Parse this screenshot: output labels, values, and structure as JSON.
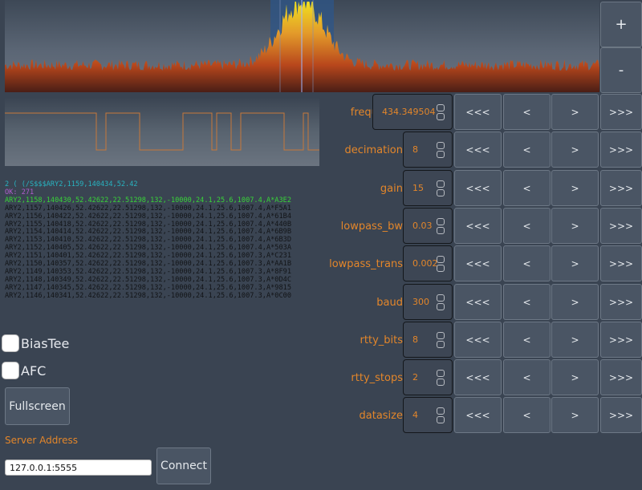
{
  "zoom": {
    "plus_label": "+",
    "minus_label": "-"
  },
  "log": {
    "top_line": "2 ( (/S$$$ARY2,1159,140434,52.42",
    "ok_line": "OK: 271",
    "new_line": "ARY2,1158,140430,52.42622,22.51298,132,-10000,24.1,25.6,1007.4,A*A3E2",
    "lines": [
      "ARY2,1157,140426,52.42622,22.51298,132,-10000,24.1,25.6,1007.4,A*F5A1",
      "ARY2,1156,140422,52.42622,22.51298,132,-10000,24.1,25.6,1007.4,A*61B4",
      "ARY2,1155,140418,52.42622,22.51298,132,-10000,24.1,25.6,1007.4,A*440B",
      "ARY2,1154,140414,52.42622,22.51298,132,-10000,24.1,25.6,1007.4,A*6B9B",
      "ARY2,1153,140410,52.42622,22.51298,132,-10000,24.1,25.6,1007.4,A*6B3D",
      "ARY2,1152,140405,52.42622,22.51298,132,-10000,24.1,25.6,1007.4,A*503A",
      "ARY2,1151,140401,52.42622,22.51298,132,-10000,24.1,25.6,1007.3,A*C231",
      "ARY2,1150,140357,52.42622,22.51298,132,-10000,24.1,25.6,1007.3,A*AA1B",
      "ARY2,1149,140353,52.42622,22.51298,132,-10000,24.1,25.6,1007.3,A*8F91",
      "ARY2,1148,140349,52.42622,22.51298,132,-10000,24.1,25.6,1007.3,A*0D4C",
      "ARY2,1147,140345,52.42622,22.51298,132,-10000,24.1,25.6,1007.3,A*9815",
      "ARY2,1146,140341,52.42622,22.51298,132,-10000,24.1,25.6,1007.3,A*0C00"
    ]
  },
  "checkboxes": {
    "biastee_label": "BiasTee",
    "afc_label": "AFC"
  },
  "fullscreen_label": "Fullscreen",
  "server": {
    "label": "Server Address",
    "value": "127.0.0.1:5555",
    "connect_label": "Connect"
  },
  "step_labels": {
    "fast_back": "<<<",
    "back": "<",
    "forward": ">",
    "fast_forward": ">>>"
  },
  "params": [
    {
      "label": "frequency",
      "value": "434.349504"
    },
    {
      "label": "decimation",
      "value": "8"
    },
    {
      "label": "gain",
      "value": "15"
    },
    {
      "label": "lowpass_bw",
      "value": "0.03"
    },
    {
      "label": "lowpass_trans",
      "value": "0.002"
    },
    {
      "label": "baud",
      "value": "300"
    },
    {
      "label": "rtty_bits",
      "value": "8"
    },
    {
      "label": "rtty_stops",
      "value": "2"
    },
    {
      "label": "datasize",
      "value": "4"
    }
  ],
  "colors": {
    "accent": "#e3862a",
    "background": "#3a4452",
    "button": "#4a5564",
    "signal": "#e8d41a"
  }
}
